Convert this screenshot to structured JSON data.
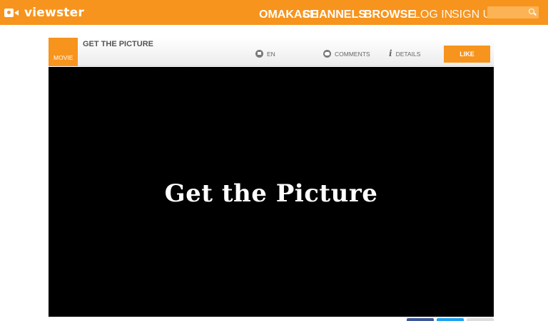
{
  "header": {
    "logo_text": "viewster",
    "nav": [
      "OMAKASE",
      "CHANNELS",
      "BROWSE"
    ],
    "auth": [
      "LOG IN",
      "SIGN UP"
    ],
    "search_placeholder": ""
  },
  "player": {
    "type_label": "MOVIE",
    "title": "GET THE PICTURE",
    "language": "EN",
    "comments_label": "COMMENTS",
    "details_label": "DETAILS",
    "like_label": "LIKE",
    "video_text": "Get the Picture"
  },
  "share": {
    "colors": [
      "#3b5998",
      "#1da1f2",
      "#dddddd"
    ]
  },
  "colors": {
    "brand": "#f7941d"
  }
}
